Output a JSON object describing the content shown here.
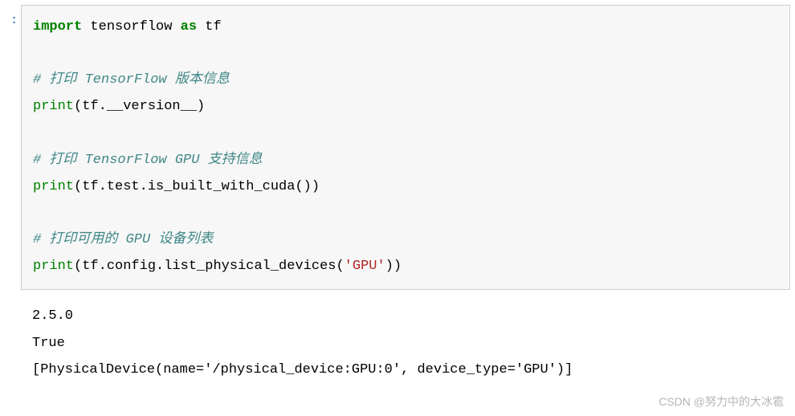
{
  "cell": {
    "prompt_suffix": ":",
    "code": {
      "l1_kw1": "import",
      "l1_mod": " tensorflow ",
      "l1_kw2": "as",
      "l1_alias": " tf",
      "blank1": "",
      "c1": "# 打印 TensorFlow 版本信息",
      "l3_fn": "print",
      "l3_rest": "(tf.__version__)",
      "blank2": "",
      "c2": "# 打印 TensorFlow GPU 支持信息",
      "l5_fn": "print",
      "l5_rest": "(tf.test.is_built_with_cuda())",
      "blank3": "",
      "c3": "# 打印可用的 GPU 设备列表",
      "l7_fn": "print",
      "l7_a": "(tf.config.list_physical_devices(",
      "l7_str": "'GPU'",
      "l7_b": "))"
    }
  },
  "output": {
    "line1": "2.5.0",
    "line2": "True",
    "line3": "[PhysicalDevice(name='/physical_device:GPU:0', device_type='GPU')]"
  },
  "watermark": "CSDN @努力中的大冰雹"
}
